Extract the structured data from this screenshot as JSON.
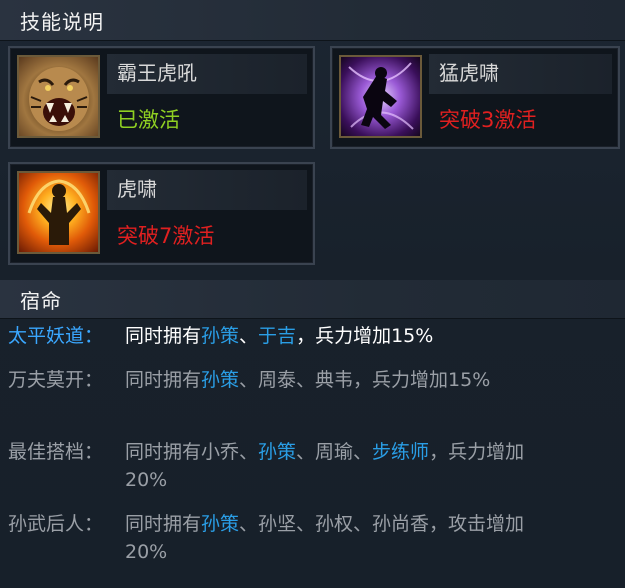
{
  "skills_header": "技能说明",
  "fate_header": "宿命",
  "skills": [
    {
      "name": "霸王虎吼",
      "status": "已激活",
      "status_color": "#8fd022",
      "icon": "tiger-roar-icon"
    },
    {
      "name": "猛虎啸",
      "status": "突破3激活",
      "status_color": "#e02020",
      "icon": "fierce-tiger-icon"
    },
    {
      "name": "虎啸",
      "status": "突破7激活",
      "status_color": "#e02020",
      "icon": "tiger-howl-icon"
    }
  ],
  "fates": [
    {
      "label": "太平妖道：",
      "active": true,
      "parts": [
        {
          "text": "同时拥有"
        },
        {
          "text": "孙策",
          "hero": true
        },
        {
          "text": "、"
        },
        {
          "text": "于吉",
          "hero": true
        },
        {
          "text": "，兵力增加15%"
        }
      ]
    },
    {
      "label": "万夫莫开：",
      "active": false,
      "parts": [
        {
          "text": "同时拥有"
        },
        {
          "text": "孙策",
          "hero": true
        },
        {
          "text": "、周泰、典韦，兵力增加15%"
        }
      ]
    },
    {
      "label": "最佳搭档：",
      "active": false,
      "parts": [
        {
          "text": "同时拥有小乔、"
        },
        {
          "text": "孙策",
          "hero": true
        },
        {
          "text": "、周瑜、"
        },
        {
          "text": "步练师",
          "hero": true
        },
        {
          "text": "，兵力增加20%"
        }
      ]
    },
    {
      "label": "孙武后人：",
      "active": false,
      "parts": [
        {
          "text": "同时拥有"
        },
        {
          "text": "孙策",
          "hero": true
        },
        {
          "text": "、孙坚、孙权、孙尚香，攻击增加20%"
        }
      ]
    }
  ],
  "colors": {
    "active_label": "#3aa7ff",
    "active_text": "#ffffff",
    "inactive_text": "#9a9fa6",
    "hero_highlight": "#2a9ee6"
  }
}
